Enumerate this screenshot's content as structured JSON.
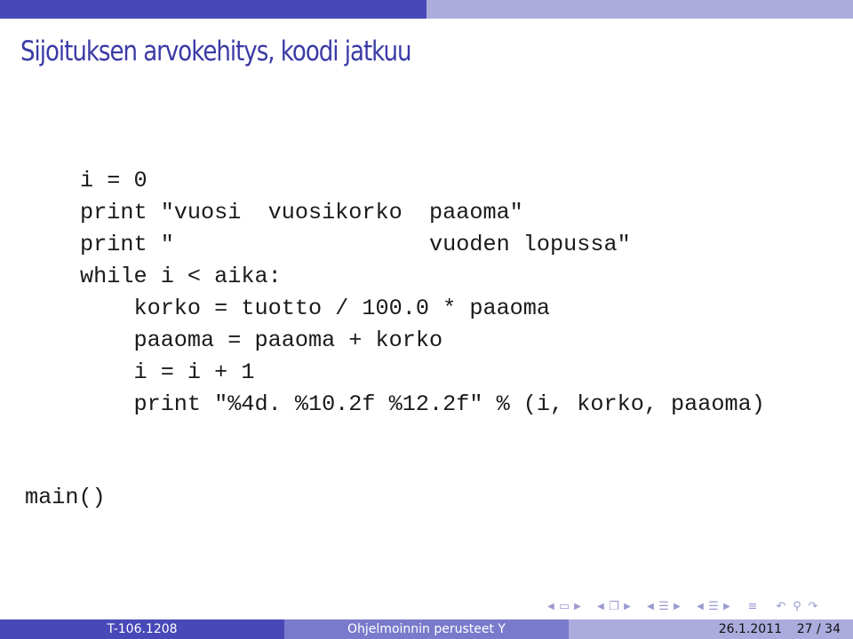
{
  "slide": {
    "title": "Sijoituksen arvokehitys, koodi jatkuu",
    "code_lines": [
      "i = 0",
      "print \"vuosi  vuosikorko  paaoma\"",
      "print \"                   vuoden lopussa\"",
      "while i < aika:",
      "    korko = tuotto / 100.0 * paaoma",
      "    paaoma = paaoma + korko",
      "    i = i + 1",
      "    print \"%4d. %10.2f %12.2f\" % (i, korko, paaoma)"
    ],
    "main_call": "main()"
  },
  "navigation": {
    "icons": [
      "prev-arrow",
      "frame-icon",
      "next-arrow",
      "prev-arrow",
      "subsection-icon",
      "next-arrow",
      "prev-arrow",
      "section-icon",
      "next-arrow",
      "prev-arrow",
      "section-icon",
      "next-arrow",
      "toc-icon",
      "undo-icon",
      "search-icon",
      "redo-icon"
    ]
  },
  "footer": {
    "course_code": "T-106.1208",
    "course_name": "Ohjelmoinnin perusteet Y",
    "date": "26.1.2011",
    "page": "27 / 34"
  },
  "colors": {
    "dark": "#4848b8",
    "medium": "#7a7acc",
    "light": "#ababdd",
    "title": "#3a3aa6"
  }
}
